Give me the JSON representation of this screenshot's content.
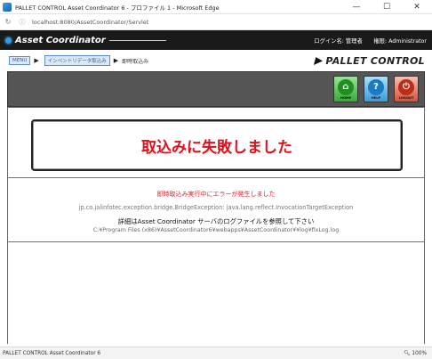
{
  "window": {
    "title": "PALLET CONTROL Asset Coordinator 6 - プロファイル 1 - Microsoft Edge",
    "min": "—",
    "max": "☐",
    "close": "✕"
  },
  "address": {
    "url": "localhost:8080/AssetCoordinator/Servlet"
  },
  "appbar": {
    "brand": "Asset Coordinator",
    "user_text": "ログイン名: 管理者　　権限: Administrator"
  },
  "breadcrumb": {
    "items": [
      "MENU",
      "インベントリデータ取込み"
    ],
    "current": "即時取込み"
  },
  "logo": {
    "text": "PALLET CONTROL"
  },
  "toolbar": {
    "home_label": "HOME",
    "help_label": "HELP",
    "logout_label": "LOGOUT"
  },
  "main": {
    "heading": "取込みに失敗しました",
    "error_message": "即時取込み実行中にエラーが発生しました",
    "exception_text": "jp.co.jalinfotec.exception.bridge.BridgeException: java.lang.reflect.InvocationTargetException",
    "instruction": "詳細はAsset Coordinator サーバのログファイルを参照して下さい",
    "log_path": "C:¥Program Files (x86)¥AssetCoordinator6¥webapps¥AssetCoordinator¥¥log¥fixLog.log"
  },
  "statusbar": {
    "text": "PALLET CONTROL Asset Coordinator 6",
    "zoom": "100%"
  },
  "colors": {
    "error_red": "#e0101a",
    "appbar_bg": "#1a1a1a",
    "toolbar_bg": "#555555"
  }
}
